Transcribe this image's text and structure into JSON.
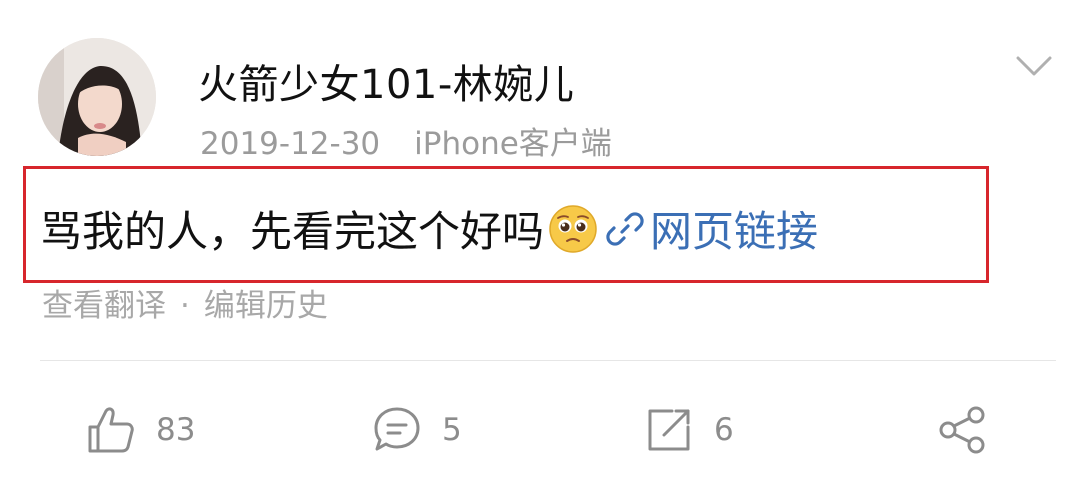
{
  "post": {
    "author": "火箭少女101-林婉儿",
    "date": "2019-12-30",
    "source": "iPhone客户端",
    "text": "骂我的人，先看完这个好吗",
    "emoji": "pleading-face-emoji",
    "link_label": "网页链接",
    "translate_label": "查看翻译",
    "separator": "·",
    "edit_history_label": "编辑历史"
  },
  "actions": {
    "likes": "83",
    "comments": "5",
    "reposts": "6"
  },
  "colors": {
    "highlight_border": "#d7262c",
    "link": "#3b6fb5",
    "muted_text": "#9b9b9b"
  }
}
